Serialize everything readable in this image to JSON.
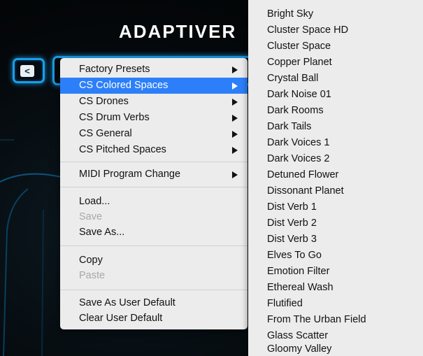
{
  "plugin": {
    "title": "ADAPTIVER",
    "back_label": "<"
  },
  "menu": {
    "items": [
      {
        "label": "Factory Presets",
        "submenu": true,
        "state": "normal"
      },
      {
        "label": "CS Colored Spaces",
        "submenu": true,
        "state": "active"
      },
      {
        "label": "CS Drones",
        "submenu": true,
        "state": "normal"
      },
      {
        "label": "CS Drum Verbs",
        "submenu": true,
        "state": "normal"
      },
      {
        "label": "CS General",
        "submenu": true,
        "state": "normal"
      },
      {
        "label": "CS Pitched Spaces",
        "submenu": true,
        "state": "normal"
      },
      {
        "label": "MIDI Program Change",
        "submenu": true,
        "state": "normal"
      },
      {
        "label": "Load...",
        "submenu": false,
        "state": "normal"
      },
      {
        "label": "Save",
        "submenu": false,
        "state": "disabled"
      },
      {
        "label": "Save As...",
        "submenu": false,
        "state": "normal"
      },
      {
        "label": "Copy",
        "submenu": false,
        "state": "normal"
      },
      {
        "label": "Paste",
        "submenu": false,
        "state": "disabled"
      },
      {
        "label": "Save As User Default",
        "submenu": false,
        "state": "normal"
      },
      {
        "label": "Clear User Default",
        "submenu": false,
        "state": "normal"
      }
    ]
  },
  "submenu": {
    "items": [
      "Bright Sky",
      "Cluster Space HD",
      "Cluster Space",
      "Copper Planet",
      "Crystal Ball",
      "Dark Noise 01",
      "Dark Rooms",
      "Dark Tails",
      "Dark Voices 1",
      "Dark Voices 2",
      "Detuned Flower",
      "Dissonant Planet",
      "Dist Verb 1",
      "Dist Verb 2",
      "Dist Verb 3",
      "Elves To Go",
      "Emotion Filter",
      "Ethereal Wash",
      "Flutified",
      "From The Urban Field",
      "Glass Scatter",
      "Gloomy Valley"
    ]
  },
  "colors": {
    "accent_blue": "#1a9ee8",
    "menu_highlight": "#2d7ff9",
    "menu_bg": "#ececec"
  }
}
